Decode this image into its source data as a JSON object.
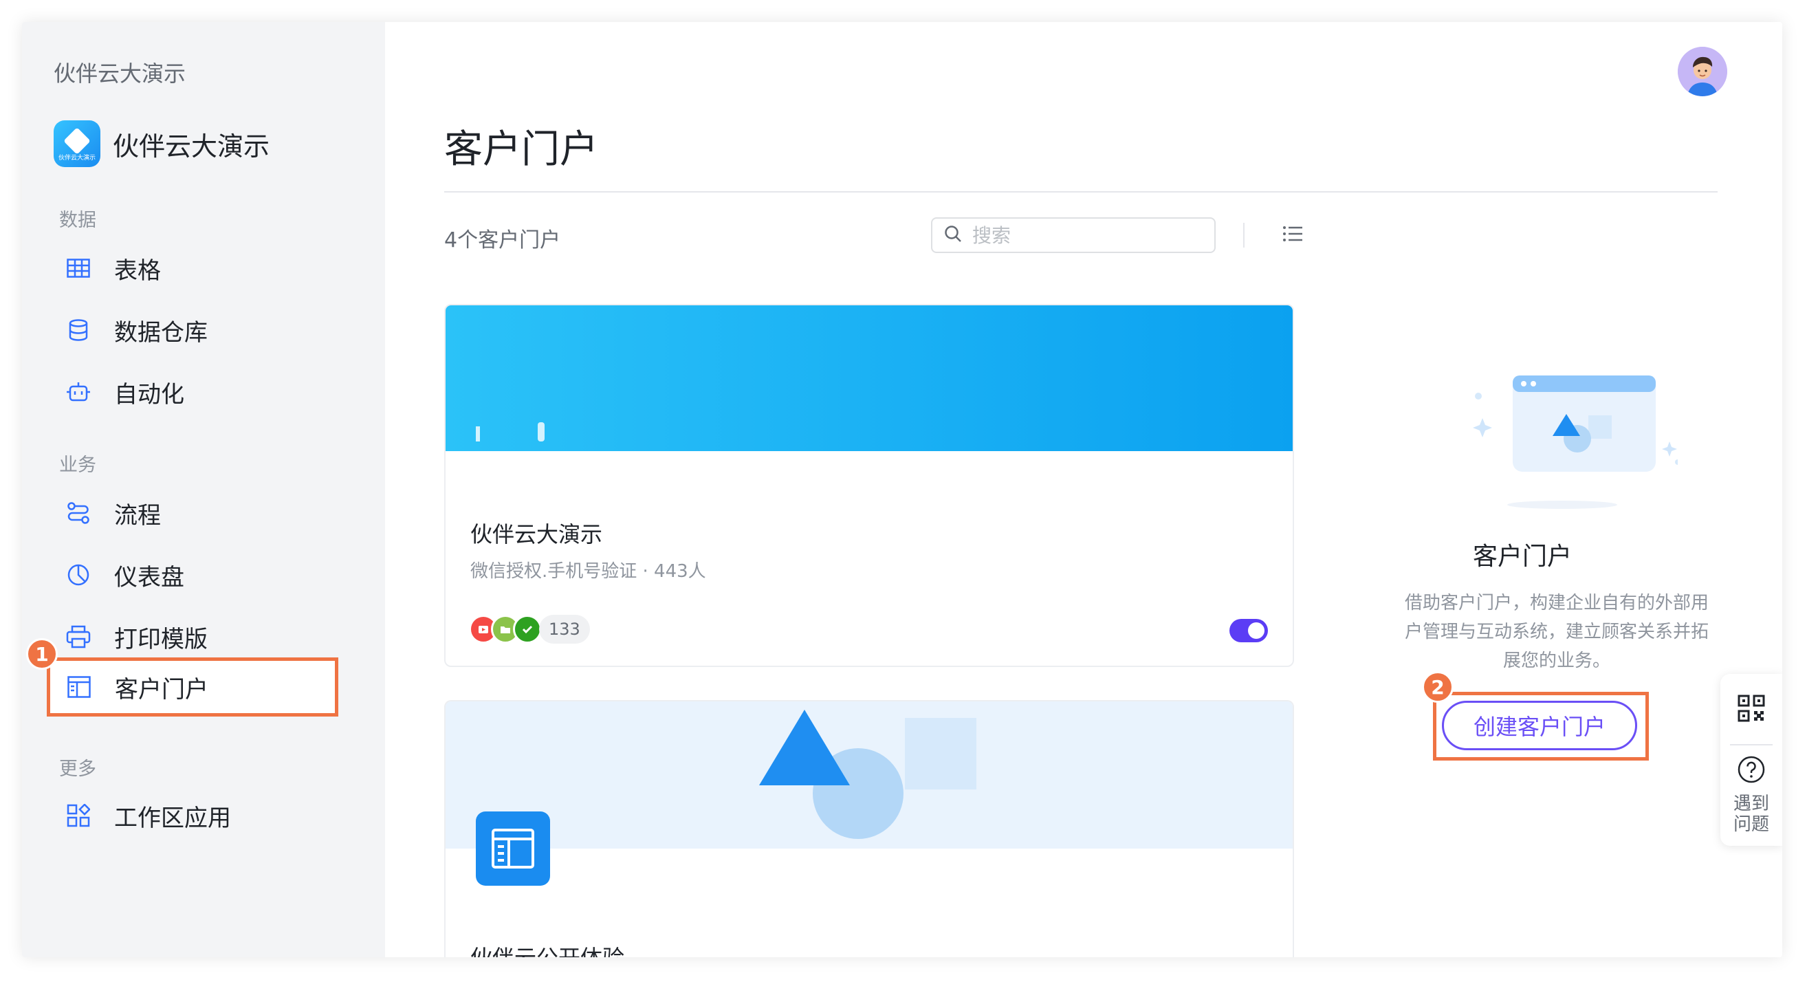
{
  "sidebar": {
    "workspace_title": "伙伴云大演示",
    "app_name": "伙伴云大演示",
    "app_logo_text": "伙伴云大演示",
    "groups": [
      {
        "label": "数据",
        "items": [
          {
            "label": "表格",
            "icon": "table-icon"
          },
          {
            "label": "数据仓库",
            "icon": "database-icon"
          },
          {
            "label": "自动化",
            "icon": "robot-icon"
          }
        ]
      },
      {
        "label": "业务",
        "items": [
          {
            "label": "流程",
            "icon": "flow-icon"
          },
          {
            "label": "仪表盘",
            "icon": "dashboard-icon"
          },
          {
            "label": "打印模版",
            "icon": "printer-icon"
          },
          {
            "label": "客户门户",
            "icon": "portal-icon",
            "active": true
          }
        ]
      },
      {
        "label": "更多",
        "items": [
          {
            "label": "工作区应用",
            "icon": "apps-icon"
          }
        ]
      }
    ]
  },
  "annotations": {
    "step1": "1",
    "step2": "2",
    "highlight_color": "#ef7343"
  },
  "header": {
    "title": "客户门户"
  },
  "toolbar": {
    "count": "4个客户门户",
    "search_placeholder": "搜索"
  },
  "cards": [
    {
      "name": "伙伴云大演示",
      "subtitle": "微信授权.手机号验证 · 443人",
      "member_count": "133",
      "enabled": true
    },
    {
      "name": "伙伴云公开体验"
    }
  ],
  "empty_panel": {
    "title": "客户门户",
    "description": "借助客户门户，构建企业自有的外部用户管理与互动系统，建立顾客关系并拓展您的业务。",
    "create_label": "创建客户门户"
  },
  "float_panel": {
    "help_line1": "遇到",
    "help_line2": "问题"
  },
  "colors": {
    "accent": "#6a4ff6",
    "brand": "#1a8cf0",
    "sidebar_bg": "#f3f4f6"
  }
}
